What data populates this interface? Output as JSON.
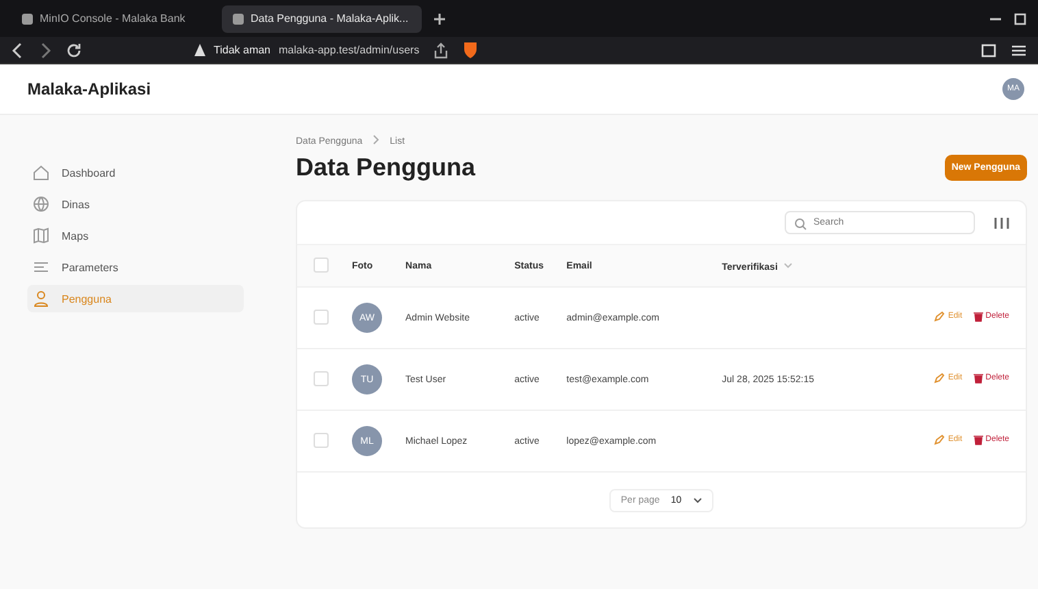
{
  "browser": {
    "tabs": [
      {
        "title": "MinIO Console - Malaka Bank",
        "selected": false
      },
      {
        "title": "Data Pengguna - Malaka-Aplik...",
        "selected": true
      }
    ],
    "address": {
      "security": "Tidak aman",
      "url": "malaka-app.test/admin/users"
    }
  },
  "app": {
    "brand": "Malaka-Aplikasi",
    "user_initials": "MA"
  },
  "sidebar": {
    "items": [
      {
        "label": "Dashboard",
        "kind": "home",
        "selected": false
      },
      {
        "label": "Dinas",
        "kind": "globe",
        "selected": false
      },
      {
        "label": "Maps",
        "kind": "map",
        "selected": false
      },
      {
        "label": "Parameters",
        "kind": "list",
        "selected": false
      },
      {
        "label": "Pengguna",
        "kind": "user",
        "selected": true
      }
    ]
  },
  "breadcrumb": [
    "Data Pengguna",
    "List"
  ],
  "page_title": "Data Pengguna",
  "new_button": "New Pengguna",
  "search": {
    "placeholder": "Search"
  },
  "table": {
    "all_checked": false,
    "columns": [
      "Foto",
      "Nama",
      "Status",
      "Email",
      "Terverifikasi"
    ],
    "rows": [
      {
        "checked": false,
        "initials": "AW",
        "name": "Admin Website",
        "status": "active",
        "email": "admin@example.com",
        "edit": "Edit",
        "delete": "Delete"
      },
      {
        "checked": false,
        "initials": "TU",
        "name": "Test User",
        "status": "active",
        "email": "test@example.com",
        "verified": "Jul 28, 2025 15:52:15",
        "edit": "Edit",
        "delete": "Delete"
      },
      {
        "checked": false,
        "initials": "ML",
        "name": "Michael Lopez",
        "status": "active",
        "email": "lopez@example.com",
        "edit": "Edit",
        "delete": "Delete"
      }
    ]
  },
  "pagination": {
    "label": "Per page",
    "value": "10"
  }
}
